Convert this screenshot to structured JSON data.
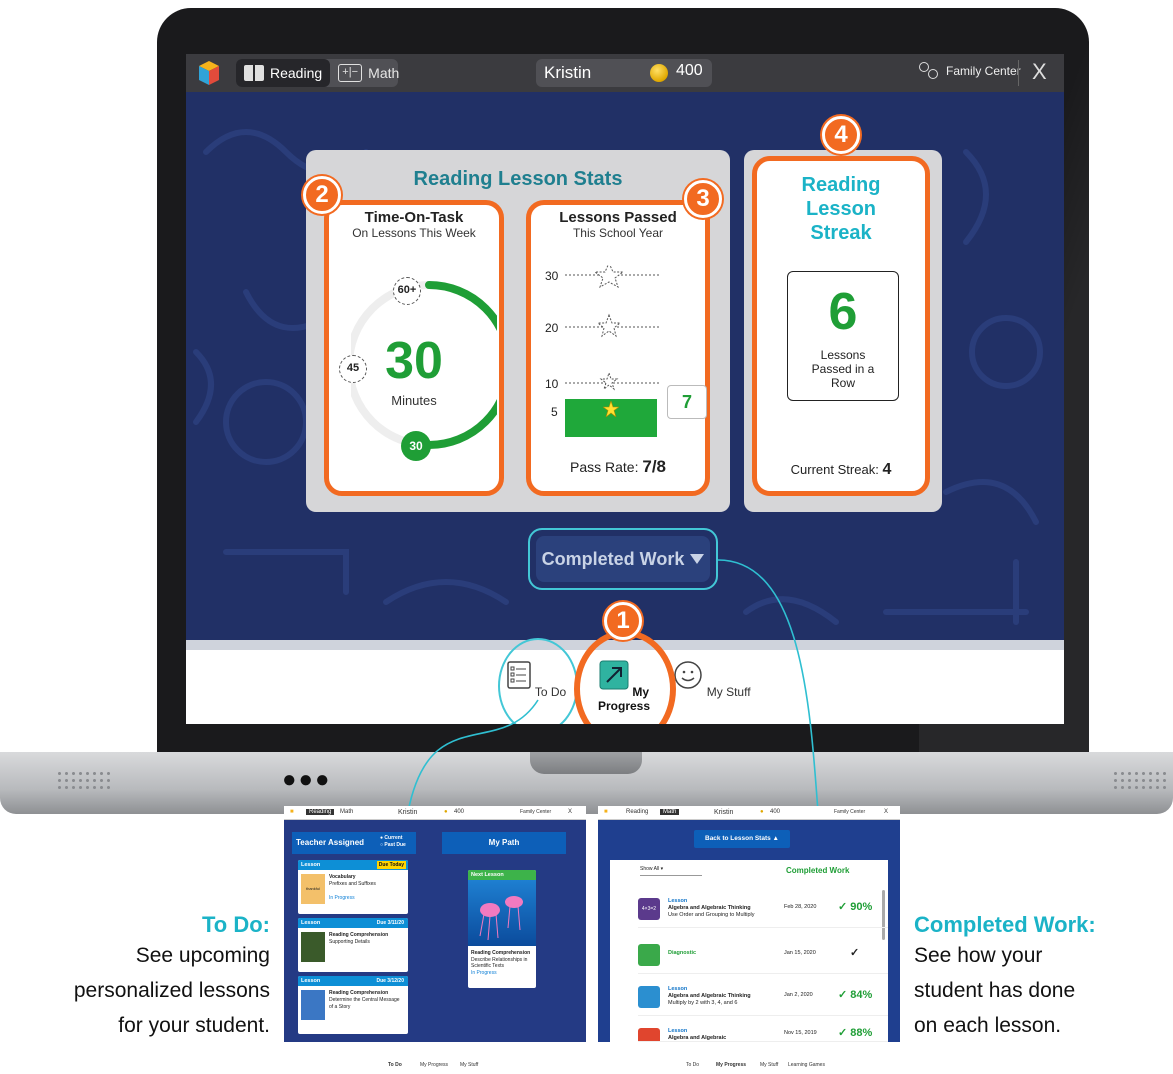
{
  "app": {
    "subjects": [
      {
        "label": "Reading"
      },
      {
        "label": "Math"
      }
    ],
    "student_name": "Kristin",
    "coins": "400",
    "family_center": "Family Center",
    "close": "X"
  },
  "stats": {
    "title": "Reading Lesson Stats",
    "time_card": {
      "title": "Time-On-Task",
      "subtitle": "On Lessons This Week",
      "value": "30",
      "unit": "Minutes",
      "marker_top": "60+",
      "marker_left": "45",
      "marker_progress": "30",
      "progress_fraction": 0.5
    },
    "lessons_card": {
      "title": "Lessons Passed",
      "subtitle": "This School Year",
      "levels": [
        "30",
        "20",
        "10",
        "5"
      ],
      "current": "7",
      "pass_rate_label": "Pass Rate:",
      "pass_rate_value": "7/8"
    },
    "streak_card": {
      "title": "Reading Lesson Streak",
      "value": "6",
      "label": "Lessons Passed in a Row",
      "current_label": "Current Streak:",
      "current_value": "4"
    }
  },
  "badges": [
    "1",
    "2",
    "3",
    "4"
  ],
  "completed_work_button": "Completed Work",
  "bottom_nav": [
    {
      "label": "To Do"
    },
    {
      "label": "My Progress"
    },
    {
      "label": "My Stuff"
    }
  ],
  "captions": {
    "todo": {
      "heading": "To Do:",
      "lines": [
        "See upcoming",
        "personalized lessons",
        "for your student."
      ]
    },
    "completed": {
      "heading": "Completed Work:",
      "lines": [
        "See how your",
        "student has done",
        "on each lesson."
      ]
    }
  },
  "mini_todo": {
    "top": {
      "reading": "Reading",
      "math": "Math",
      "name": "Kristin",
      "coins": "400",
      "family": "Family Center",
      "close": "X"
    },
    "teacher_assigned": "Teacher Assigned",
    "legend_current": "Current",
    "legend_past_due": "Past Due",
    "my_path": "My Path",
    "lessons": [
      {
        "header": "Lesson",
        "due": "Due Today",
        "title": "Vocabulary",
        "desc": "Prefixes and Suffixes",
        "status": "In Progress",
        "thumb_text": "thankful"
      },
      {
        "header": "Lesson",
        "due": "Due 3/11/20",
        "title": "Reading Comprehension",
        "desc": "Supporting Details",
        "status": ""
      },
      {
        "header": "Lesson",
        "due": "Due 3/12/20",
        "title": "Reading Comprehension",
        "desc": "Determine the Central Message of a Story",
        "status": ""
      }
    ],
    "next_lesson": {
      "header": "Next Lesson",
      "title": "Reading Comprehension",
      "desc": "Describe Relationships in Scientific Texts",
      "status": "In Progress"
    },
    "nav": [
      "To Do",
      "My Progress",
      "My Stuff"
    ]
  },
  "mini_completed": {
    "top": {
      "reading": "Reading",
      "math": "Math",
      "name": "Kristin",
      "coins": "400",
      "family": "Family Center",
      "close": "X"
    },
    "back_button": "Back to Lesson Stats",
    "filter": "Show All",
    "heading": "Completed Work",
    "rows": [
      {
        "type": "Lesson",
        "title": "Algebra and Algebraic Thinking",
        "desc": "Use Order and Grouping to Multiply",
        "date": "Feb 28, 2020",
        "score": "✓ 90%"
      },
      {
        "type": "Diagnostic",
        "title": "",
        "desc": "",
        "date": "Jan 15, 2020",
        "score": "✓"
      },
      {
        "type": "Lesson",
        "title": "Algebra and Algebraic Thinking",
        "desc": "Multiply by 2 with 3, 4, and 6",
        "date": "Jan 2, 2020",
        "score": "✓ 84%"
      },
      {
        "type": "Lesson",
        "title": "Algebra and Algebraic",
        "desc": "",
        "date": "Nov 15, 2019",
        "score": "✓ 88%"
      }
    ],
    "nav": [
      "To Do",
      "My Progress",
      "My Stuff",
      "Learning Games"
    ]
  },
  "colors": {
    "accent_orange": "#f26a21",
    "teal": "#1bb3c7",
    "green": "#1f9e36",
    "navy": "#213066"
  }
}
